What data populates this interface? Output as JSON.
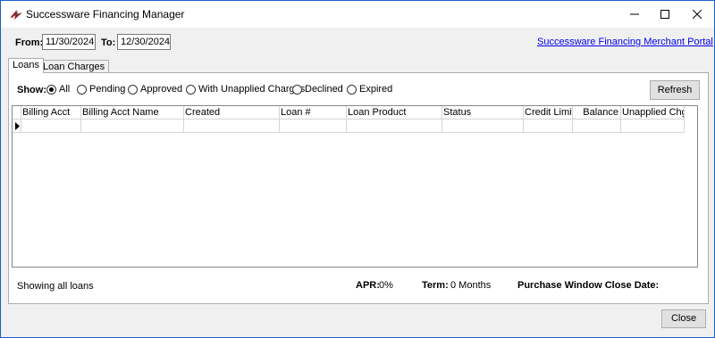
{
  "window": {
    "title": "Successware Financing Manager",
    "icon": "successware-logo-icon",
    "controls": [
      "minimize-icon",
      "maximize-icon",
      "close-icon"
    ]
  },
  "filters": {
    "from_label": "From:",
    "from_value": "11/30/2024",
    "to_label": "To:",
    "to_value": "12/30/2024"
  },
  "portal_link": "Successware Financing Merchant Portal",
  "tabs": [
    {
      "label": "Loans",
      "active": true
    },
    {
      "label": "Loan Charges",
      "active": false
    }
  ],
  "show": {
    "label": "Show:",
    "options": [
      {
        "label": "All",
        "checked": true
      },
      {
        "label": "Pending",
        "checked": false
      },
      {
        "label": "Approved",
        "checked": false
      },
      {
        "label": "With Unapplied Charges",
        "checked": false
      },
      {
        "label": "Declined",
        "checked": false
      },
      {
        "label": "Expired",
        "checked": false
      }
    ]
  },
  "refresh_label": "Refresh",
  "grid": {
    "columns": [
      "Billing Acct",
      "Billing Acct Name",
      "Created",
      "Loan #",
      "Loan Product",
      "Status",
      "Credit Limit",
      "Balance",
      "Unapplied Chgs"
    ],
    "current_row_indicator": "row-selector-arrow-icon"
  },
  "footer": {
    "status_text": "Showing all loans",
    "apr_label": "APR:",
    "apr_value": "0%",
    "term_label": "Term:",
    "term_value": "0 Months",
    "purchase_window_label": "Purchase Window Close Date:"
  },
  "close_label": "Close",
  "colors": {
    "window_border": "#1a5fd0",
    "link": "#0000ee",
    "background": "#f0f0f0"
  }
}
